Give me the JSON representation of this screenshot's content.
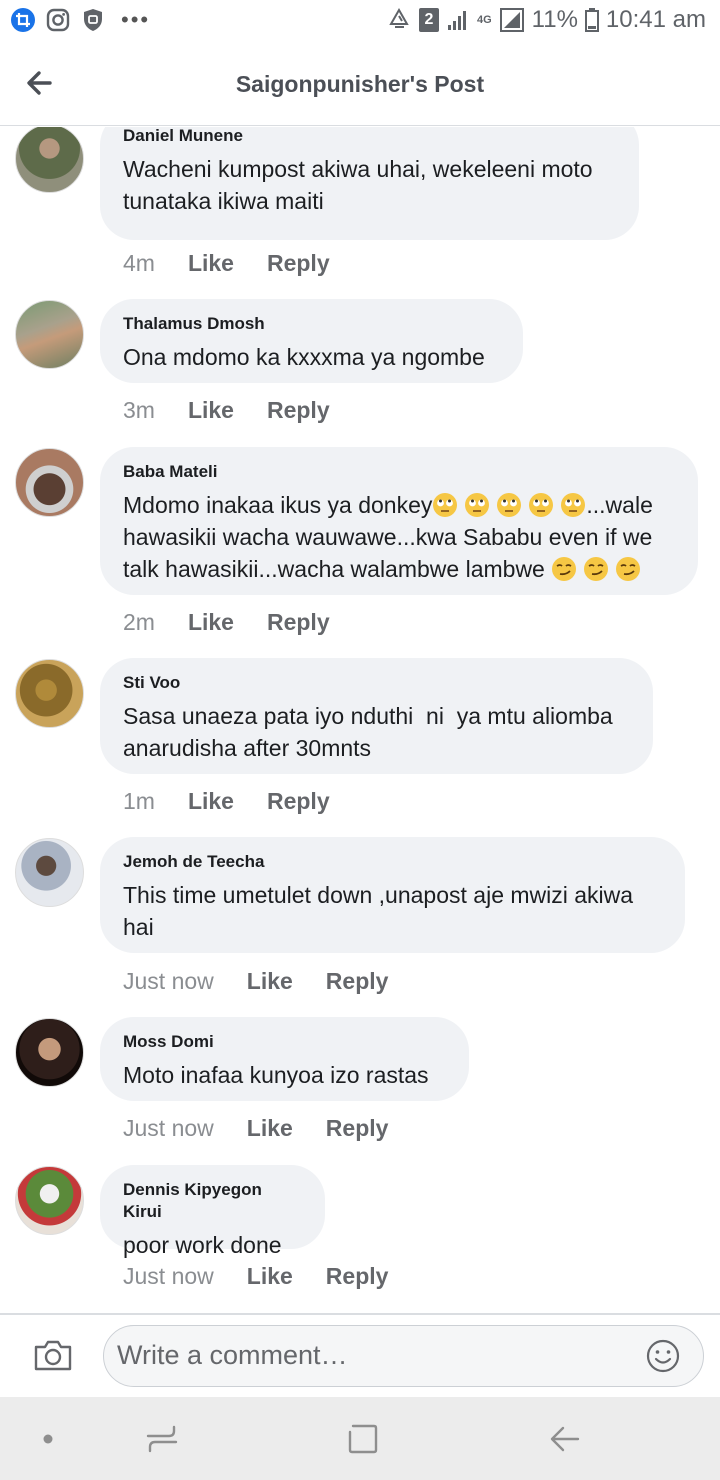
{
  "status_bar": {
    "signal_type": "4G",
    "sim_badge": "2",
    "battery": "11%",
    "time": "10:41 am",
    "more": "•••"
  },
  "header": {
    "title": "Saigonpunisher's Post",
    "back_icon": "arrow-left-icon"
  },
  "comments": [
    {
      "author": "Daniel Munene",
      "text": "Wacheni kumpost akiwa uhai, wekeleeni moto tunataka ikiwa maiti",
      "time": "4m",
      "like": "Like",
      "reply": "Reply"
    },
    {
      "author": "Thalamus Dmosh",
      "text": "Ona mdomo ka kxxxma ya ngombe",
      "time": "3m",
      "like": "Like",
      "reply": "Reply"
    },
    {
      "author": "Baba Mateli",
      "text_parts": [
        "Mdomo inakaa ikus ya donkey",
        "...wale hawasikii wacha wauwawe...kwa Sababu even if we talk hawasikii...wacha walambwe lambwe "
      ],
      "emoji_1": "rolling-eyes-emoji",
      "emoji_2": "smirk-emoji",
      "time": "2m",
      "like": "Like",
      "reply": "Reply"
    },
    {
      "author": "Sti Voo",
      "text": "Sasa unaeza pata iyo nduthi  ni  ya mtu aliomba anarudisha after 30mnts",
      "time": "1m",
      "like": "Like",
      "reply": "Reply"
    },
    {
      "author": "Jemoh de Teecha",
      "text": "This time umetulet down ,unapost aje mwizi akiwa hai",
      "time": "Just now",
      "like": "Like",
      "reply": "Reply"
    },
    {
      "author": "Moss Domi",
      "text": "Moto inafaa kunyoa izo rastas",
      "time": "Just now",
      "like": "Like",
      "reply": "Reply"
    },
    {
      "author": "Dennis Kipyegon Kirui",
      "text": "poor work done",
      "time": "Just now",
      "like": "Like",
      "reply": "Reply"
    }
  ],
  "composer": {
    "placeholder": "Write a comment…",
    "camera_icon": "camera-icon",
    "emoji_icon": "smiley-icon"
  },
  "nav": {
    "icons": [
      "dot-icon",
      "recent-apps-icon",
      "home-icon",
      "back-icon"
    ]
  }
}
